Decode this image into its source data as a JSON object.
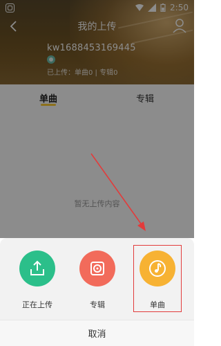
{
  "status_bar": {
    "time": "2:50"
  },
  "nav": {
    "title": "我的上传"
  },
  "user": {
    "name": "kw1688453169445",
    "upload_stats": "已上传：单曲0 | 专辑0"
  },
  "tabs": [
    {
      "label": "单曲",
      "active": true
    },
    {
      "label": "专辑",
      "active": false
    }
  ],
  "content": {
    "empty_text": "暂无上传内容"
  },
  "sheet": {
    "actions": [
      {
        "label": "正在上传",
        "icon": "upload-icon",
        "color": "#2bbf8a"
      },
      {
        "label": "专辑",
        "icon": "album-icon",
        "color": "#f26b5b"
      },
      {
        "label": "单曲",
        "icon": "music-note-icon",
        "color": "#f7b233"
      }
    ],
    "cancel_label": "取消"
  },
  "colors": {
    "accent_tab": "#ffcc33",
    "annotation_red": "#e23b3b"
  }
}
